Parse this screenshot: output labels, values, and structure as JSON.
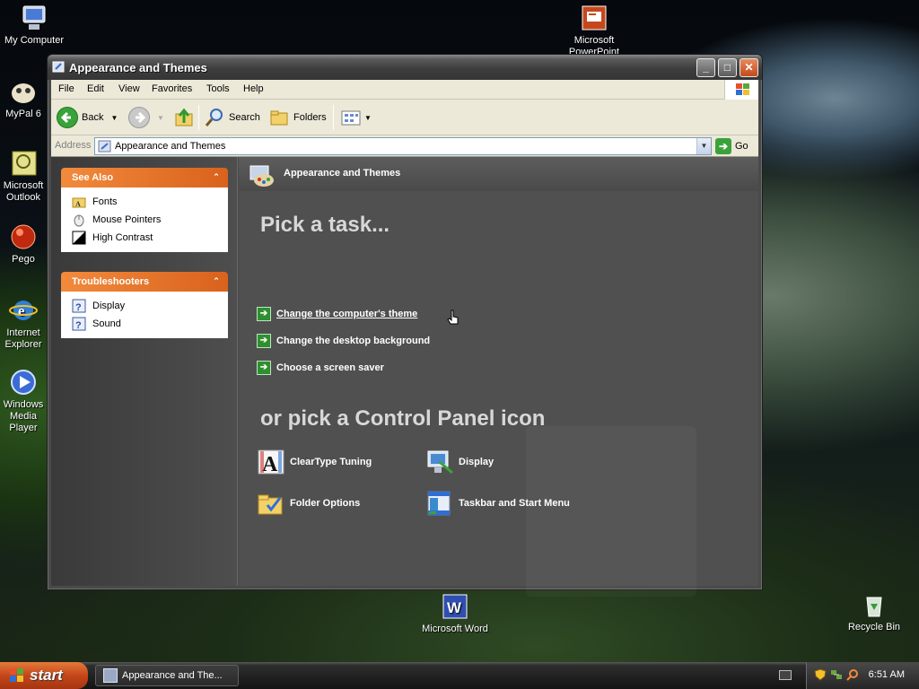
{
  "desktop": {
    "icons": {
      "my_computer": "My Computer",
      "mypal": "MyPal 6",
      "outlook": "Microsoft Outlook",
      "pego": "Pego",
      "ie": "Internet Explorer",
      "wmp": "Windows Media Player",
      "powerpoint": "Microsoft PowerPoint",
      "word": "Microsoft Word",
      "recycle_bin": "Recycle Bin"
    }
  },
  "window": {
    "title": "Appearance and Themes",
    "controls": {
      "minimize": "_",
      "maximize": "□",
      "close": "✕"
    },
    "menu": [
      "File",
      "Edit",
      "View",
      "Favorites",
      "Tools",
      "Help"
    ],
    "toolbar": {
      "back_label": "Back",
      "search_label": "Search",
      "folders_label": "Folders"
    },
    "address": {
      "label": "Address",
      "value": "Appearance and Themes",
      "go_label": "Go"
    }
  },
  "see_also": {
    "title": "See Also",
    "items": [
      "Fonts",
      "Mouse Pointers",
      "High Contrast"
    ]
  },
  "troubleshooters": {
    "title": "Troubleshooters",
    "items": [
      "Display",
      "Sound"
    ]
  },
  "content": {
    "header_title": "Appearance and Themes",
    "pick_task": "Pick a task...",
    "tasks": [
      "Change the computer's theme",
      "Change the desktop background",
      "Choose a screen saver"
    ],
    "pick_icon": "or pick a Control Panel icon",
    "icons": [
      "ClearType Tuning",
      "Display",
      "Folder Options",
      "Taskbar and Start Menu"
    ]
  },
  "taskbar": {
    "start_label": "start",
    "task_button": "Appearance and The...",
    "clock": "6:51 AM"
  },
  "colors": {
    "accent_orange": "#d9621c",
    "task_arrow_green": "#2f8f2f",
    "content_bg": "#505050"
  }
}
